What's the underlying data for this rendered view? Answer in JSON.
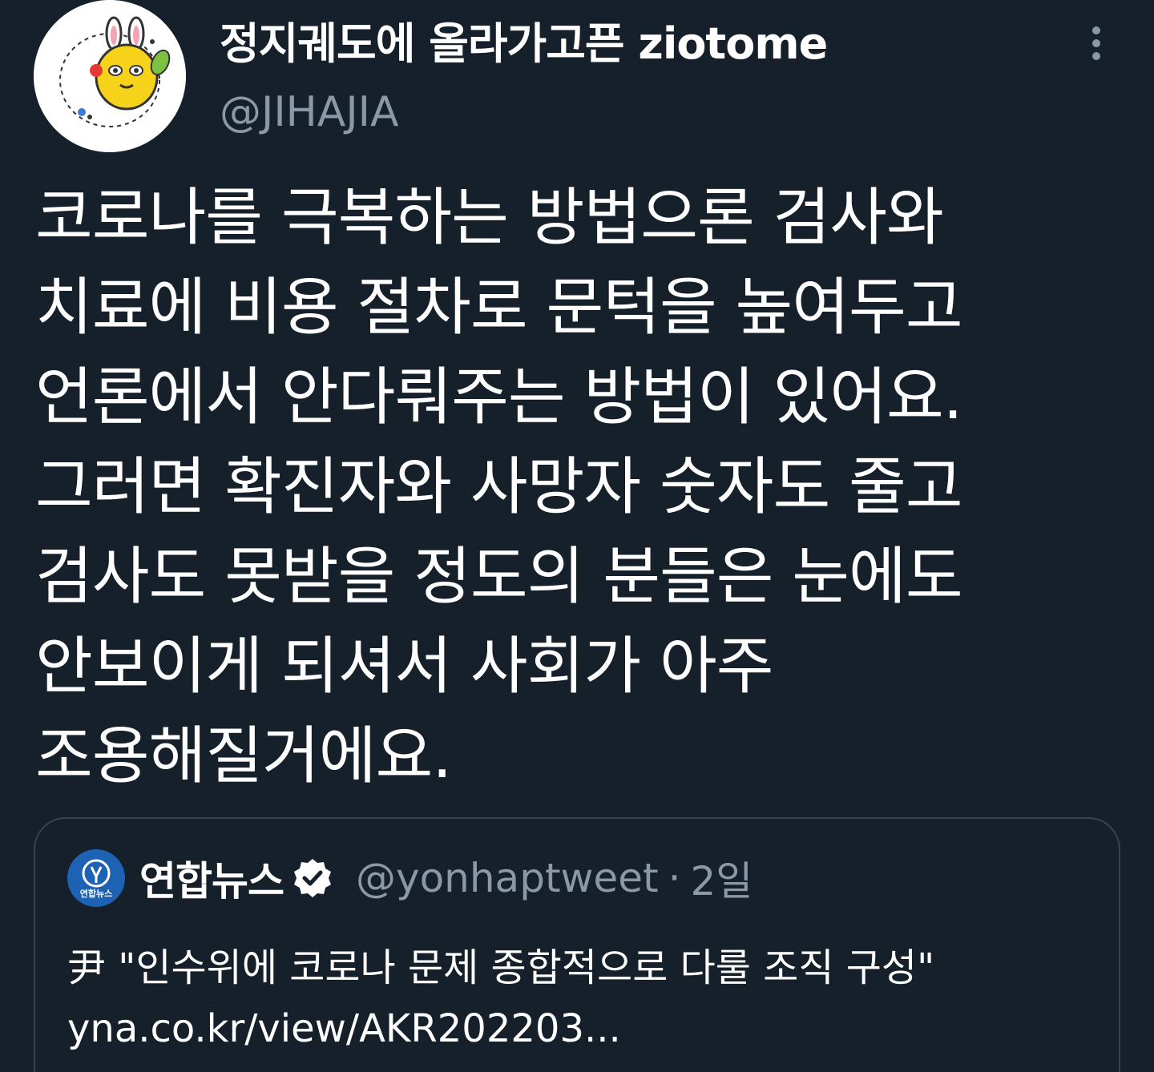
{
  "tweet": {
    "display_name": "정지궤도에 올라가고픈 ziotome",
    "handle": "@JIHAJIA",
    "body_lines": [
      "코로나를 극복하는 방법으론 검사와",
      "치료에 비용 절차로 문턱을 높여두고",
      "언론에서 안다뤄주는 방법이 있어요.",
      "그러면 확진자와 사망자 숫자도 줄고",
      "검사도 못받을 정도의 분들은 눈에도",
      "안보이게 되셔서 사회가 아주",
      "조용해질거에요."
    ],
    "more_icon": "more-vertical-icon"
  },
  "quote": {
    "avatar_text": "연합뉴스",
    "name": "연합뉴스",
    "verified_icon": "verified-badge-icon",
    "handle": "@yonhaptweet",
    "separator": "·",
    "time": "2일",
    "text_lines": [
      "尹 \"인수위에 코로나 문제 종합적으로 다룰 조직 구성\"",
      "yna.co.kr/view/AKR202203..."
    ]
  },
  "colors": {
    "background": "#15202b",
    "text": "#ffffff",
    "secondary": "#8b98a5",
    "border": "#38444d",
    "yonhap_blue": "#1e63b3"
  }
}
